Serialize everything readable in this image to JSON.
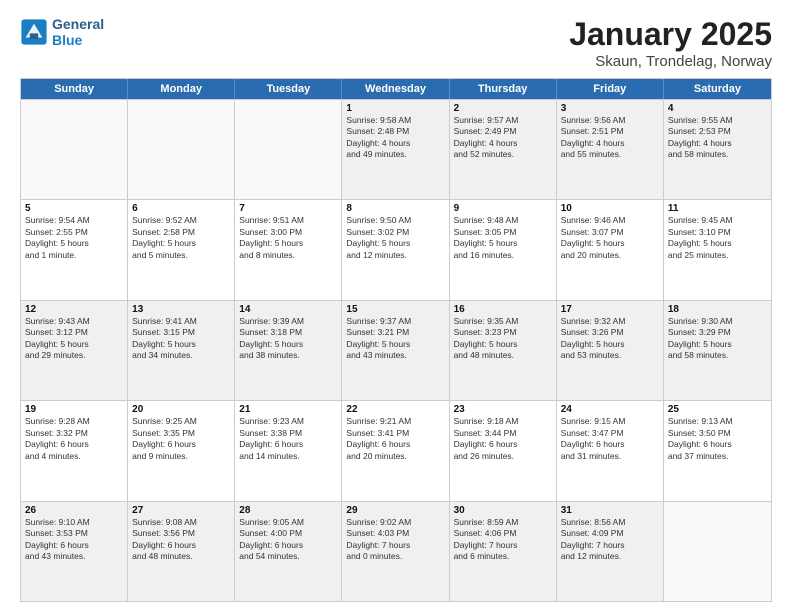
{
  "logo": {
    "line1": "General",
    "line2": "Blue"
  },
  "title": {
    "month": "January 2025",
    "location": "Skaun, Trondelag, Norway"
  },
  "header_days": [
    "Sunday",
    "Monday",
    "Tuesday",
    "Wednesday",
    "Thursday",
    "Friday",
    "Saturday"
  ],
  "weeks": [
    [
      {
        "day": "",
        "text": "",
        "empty": true
      },
      {
        "day": "",
        "text": "",
        "empty": true
      },
      {
        "day": "",
        "text": "",
        "empty": true
      },
      {
        "day": "1",
        "text": "Sunrise: 9:58 AM\nSunset: 2:48 PM\nDaylight: 4 hours\nand 49 minutes."
      },
      {
        "day": "2",
        "text": "Sunrise: 9:57 AM\nSunset: 2:49 PM\nDaylight: 4 hours\nand 52 minutes."
      },
      {
        "day": "3",
        "text": "Sunrise: 9:56 AM\nSunset: 2:51 PM\nDaylight: 4 hours\nand 55 minutes."
      },
      {
        "day": "4",
        "text": "Sunrise: 9:55 AM\nSunset: 2:53 PM\nDaylight: 4 hours\nand 58 minutes."
      }
    ],
    [
      {
        "day": "5",
        "text": "Sunrise: 9:54 AM\nSunset: 2:55 PM\nDaylight: 5 hours\nand 1 minute."
      },
      {
        "day": "6",
        "text": "Sunrise: 9:52 AM\nSunset: 2:58 PM\nDaylight: 5 hours\nand 5 minutes."
      },
      {
        "day": "7",
        "text": "Sunrise: 9:51 AM\nSunset: 3:00 PM\nDaylight: 5 hours\nand 8 minutes."
      },
      {
        "day": "8",
        "text": "Sunrise: 9:50 AM\nSunset: 3:02 PM\nDaylight: 5 hours\nand 12 minutes."
      },
      {
        "day": "9",
        "text": "Sunrise: 9:48 AM\nSunset: 3:05 PM\nDaylight: 5 hours\nand 16 minutes."
      },
      {
        "day": "10",
        "text": "Sunrise: 9:46 AM\nSunset: 3:07 PM\nDaylight: 5 hours\nand 20 minutes."
      },
      {
        "day": "11",
        "text": "Sunrise: 9:45 AM\nSunset: 3:10 PM\nDaylight: 5 hours\nand 25 minutes."
      }
    ],
    [
      {
        "day": "12",
        "text": "Sunrise: 9:43 AM\nSunset: 3:12 PM\nDaylight: 5 hours\nand 29 minutes."
      },
      {
        "day": "13",
        "text": "Sunrise: 9:41 AM\nSunset: 3:15 PM\nDaylight: 5 hours\nand 34 minutes."
      },
      {
        "day": "14",
        "text": "Sunrise: 9:39 AM\nSunset: 3:18 PM\nDaylight: 5 hours\nand 38 minutes."
      },
      {
        "day": "15",
        "text": "Sunrise: 9:37 AM\nSunset: 3:21 PM\nDaylight: 5 hours\nand 43 minutes."
      },
      {
        "day": "16",
        "text": "Sunrise: 9:35 AM\nSunset: 3:23 PM\nDaylight: 5 hours\nand 48 minutes."
      },
      {
        "day": "17",
        "text": "Sunrise: 9:32 AM\nSunset: 3:26 PM\nDaylight: 5 hours\nand 53 minutes."
      },
      {
        "day": "18",
        "text": "Sunrise: 9:30 AM\nSunset: 3:29 PM\nDaylight: 5 hours\nand 58 minutes."
      }
    ],
    [
      {
        "day": "19",
        "text": "Sunrise: 9:28 AM\nSunset: 3:32 PM\nDaylight: 6 hours\nand 4 minutes."
      },
      {
        "day": "20",
        "text": "Sunrise: 9:25 AM\nSunset: 3:35 PM\nDaylight: 6 hours\nand 9 minutes."
      },
      {
        "day": "21",
        "text": "Sunrise: 9:23 AM\nSunset: 3:38 PM\nDaylight: 6 hours\nand 14 minutes."
      },
      {
        "day": "22",
        "text": "Sunrise: 9:21 AM\nSunset: 3:41 PM\nDaylight: 6 hours\nand 20 minutes."
      },
      {
        "day": "23",
        "text": "Sunrise: 9:18 AM\nSunset: 3:44 PM\nDaylight: 6 hours\nand 26 minutes."
      },
      {
        "day": "24",
        "text": "Sunrise: 9:15 AM\nSunset: 3:47 PM\nDaylight: 6 hours\nand 31 minutes."
      },
      {
        "day": "25",
        "text": "Sunrise: 9:13 AM\nSunset: 3:50 PM\nDaylight: 6 hours\nand 37 minutes."
      }
    ],
    [
      {
        "day": "26",
        "text": "Sunrise: 9:10 AM\nSunset: 3:53 PM\nDaylight: 6 hours\nand 43 minutes."
      },
      {
        "day": "27",
        "text": "Sunrise: 9:08 AM\nSunset: 3:56 PM\nDaylight: 6 hours\nand 48 minutes."
      },
      {
        "day": "28",
        "text": "Sunrise: 9:05 AM\nSunset: 4:00 PM\nDaylight: 6 hours\nand 54 minutes."
      },
      {
        "day": "29",
        "text": "Sunrise: 9:02 AM\nSunset: 4:03 PM\nDaylight: 7 hours\nand 0 minutes."
      },
      {
        "day": "30",
        "text": "Sunrise: 8:59 AM\nSunset: 4:06 PM\nDaylight: 7 hours\nand 6 minutes."
      },
      {
        "day": "31",
        "text": "Sunrise: 8:56 AM\nSunset: 4:09 PM\nDaylight: 7 hours\nand 12 minutes."
      },
      {
        "day": "",
        "text": "",
        "empty": true
      }
    ]
  ]
}
